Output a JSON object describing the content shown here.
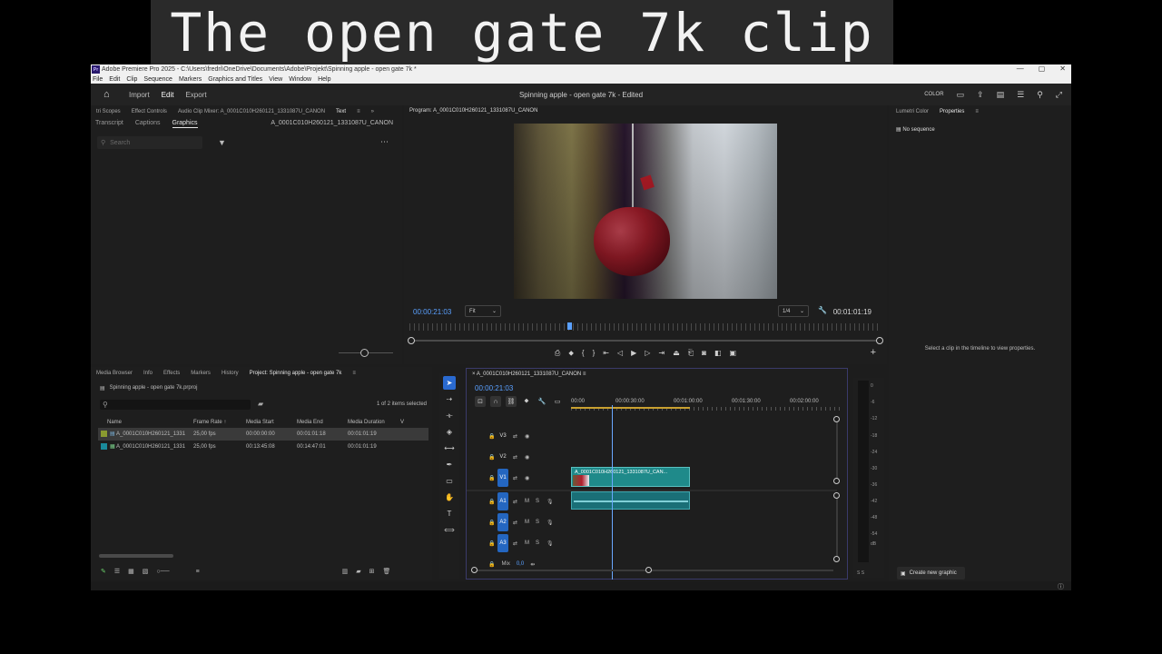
{
  "caption": "The open gate 7k clip",
  "window": {
    "title": "Adobe Premiere Pro 2025 - C:\\Users\\fredri\\OneDrive\\Documents\\Adobe\\Projekt\\Spinning apple - open gate 7k *",
    "app_badge": "Pr",
    "minimize": "—",
    "maximize": "▢",
    "close": "✕"
  },
  "menu": [
    "File",
    "Edit",
    "Clip",
    "Sequence",
    "Markers",
    "Graphics and Titles",
    "View",
    "Window",
    "Help"
  ],
  "header": {
    "nav": [
      "Import",
      "Edit",
      "Export"
    ],
    "active_nav": "Edit",
    "doc_title": "Spinning apple - open gate 7k - Edited",
    "color_label": "COLOR"
  },
  "top_left": {
    "tabs": [
      "tri Scopes",
      "Effect Controls",
      "Audio Clip Mixer: A_0001C010H260121_1331087U_CANON",
      "Text"
    ],
    "active_tab": "Text",
    "subtabs": [
      "Transcript",
      "Captions",
      "Graphics"
    ],
    "active_subtab": "Graphics",
    "clip_name": "A_0001C010H260121_1331087U_CANON",
    "search_placeholder": "Search"
  },
  "program": {
    "title": "Program: A_0001C010H260121_1331087U_CANON",
    "timecode_current": "00:00:21:03",
    "fit_label": "Fit",
    "quality": "1/4",
    "timecode_duration": "00:01:01:19"
  },
  "right_panel": {
    "tabs": [
      "Lumetri Color",
      "Properties"
    ],
    "active_tab": "Properties",
    "no_sequence": "No sequence",
    "select_msg": "Select a clip in the timeline to view properties.",
    "create_graphic": "Create new graphic"
  },
  "project": {
    "tabs": [
      "Media Browser",
      "Info",
      "Effects",
      "Markers",
      "History",
      "Project: Spinning apple - open gate 7k"
    ],
    "active_tab": "Project: Spinning apple - open gate 7k",
    "path": "Spinning apple - open gate 7k.prproj",
    "selected_count": "1 of 2 items selected",
    "columns": [
      "Name",
      "Frame Rate",
      "Media Start",
      "Media End",
      "Media Duration",
      "V"
    ],
    "rows": [
      {
        "name": "A_0001C010H260121_1331",
        "frame_rate": "25,00 fps",
        "media_start": "00:00:00:00",
        "media_end": "00:01:01:18",
        "media_duration": "00:01:01:19",
        "swatch": "#8a9a30",
        "selected": true
      },
      {
        "name": "A_0001C010H260121_1331",
        "frame_rate": "25,00 fps",
        "media_start": "00:13:45:08",
        "media_end": "00:14:47:01",
        "media_duration": "00:01:01:19",
        "swatch": "#1a8a9a",
        "selected": false
      }
    ]
  },
  "timeline": {
    "name": "A_0001C010H260121_1331087U_CANON",
    "timecode": "00:00:21:03",
    "ruler": [
      "00:00",
      "00:00:30:00",
      "00:01:00:00",
      "00:01:30:00",
      "00:02:00:00"
    ],
    "video_tracks": [
      "V3",
      "V2",
      "V1"
    ],
    "audio_tracks": [
      "A1",
      "A2",
      "A3"
    ],
    "clip_label": "A_0001C010H260121_1331087U_CAN...",
    "mix_label": "Mix",
    "mix_value": "0,0"
  },
  "meter": {
    "labels": [
      "0",
      "-6",
      "-12",
      "-18",
      "-24",
      "-30",
      "-36",
      "-42",
      "-48",
      "-54",
      "dB"
    ],
    "solo": "S  S"
  },
  "colors": {
    "accent_blue": "#2466c0",
    "timecode_blue": "#5aa0ff",
    "clip_teal": "#1f8a8a"
  }
}
